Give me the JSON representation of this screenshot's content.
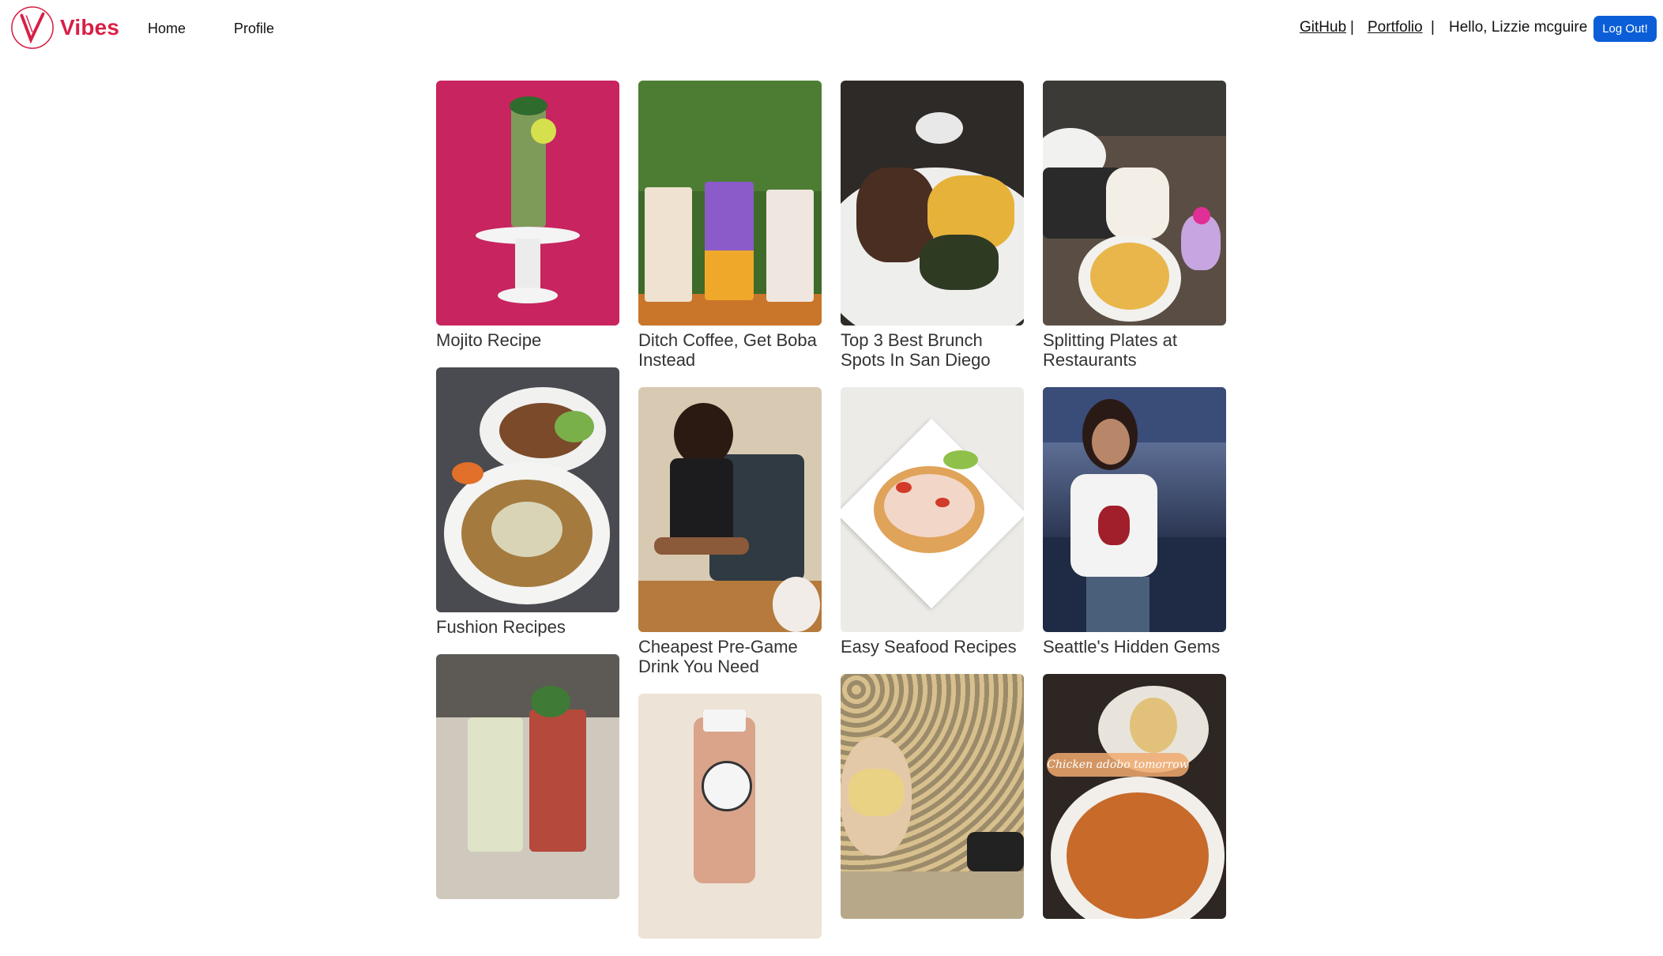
{
  "brand": {
    "name": "Vibes",
    "color": "#d81f45"
  },
  "nav": {
    "home": "Home",
    "profile": "Profile",
    "github": "GitHub",
    "sep1": "|",
    "portfolio": "Portfolio",
    "sep2": "|",
    "greeting": "Hello, Lizzie mcguire",
    "logout": "Log Out!"
  },
  "posts": {
    "col1": [
      {
        "title": "Mojito Recipe",
        "image": "mojito-photo"
      },
      {
        "title": "Fushion Recipes",
        "image": "pho-bowl-photo"
      },
      {
        "title": "",
        "image": "cocktails-photo"
      }
    ],
    "col2": [
      {
        "title": "Ditch Coffee, Get Boba Instead",
        "image": "boba-drinks-photo"
      },
      {
        "title": "Cheapest Pre-Game Drink You Need",
        "image": "woman-drinking-photo"
      },
      {
        "title": "",
        "image": "bottled-drink-photo"
      }
    ],
    "col3": [
      {
        "title": "Top 3 Best Brunch Spots In San Diego",
        "image": "brunch-plate-photo"
      },
      {
        "title": "Easy Seafood Recipes",
        "image": "seafood-tostada-photo"
      },
      {
        "title": "",
        "image": "pasta-shapes-photo"
      }
    ],
    "col4": [
      {
        "title": "Splitting Plates at Restaurants",
        "image": "shared-plates-photo"
      },
      {
        "title": "Seattle's Hidden Gems",
        "image": "woman-city-view-photo"
      },
      {
        "title": "",
        "image": "chicken-adobo-photo",
        "overlay_text": "Chicken adobo tomorrow"
      }
    ]
  },
  "colors": {
    "logout_button": "#0b5ed7"
  }
}
